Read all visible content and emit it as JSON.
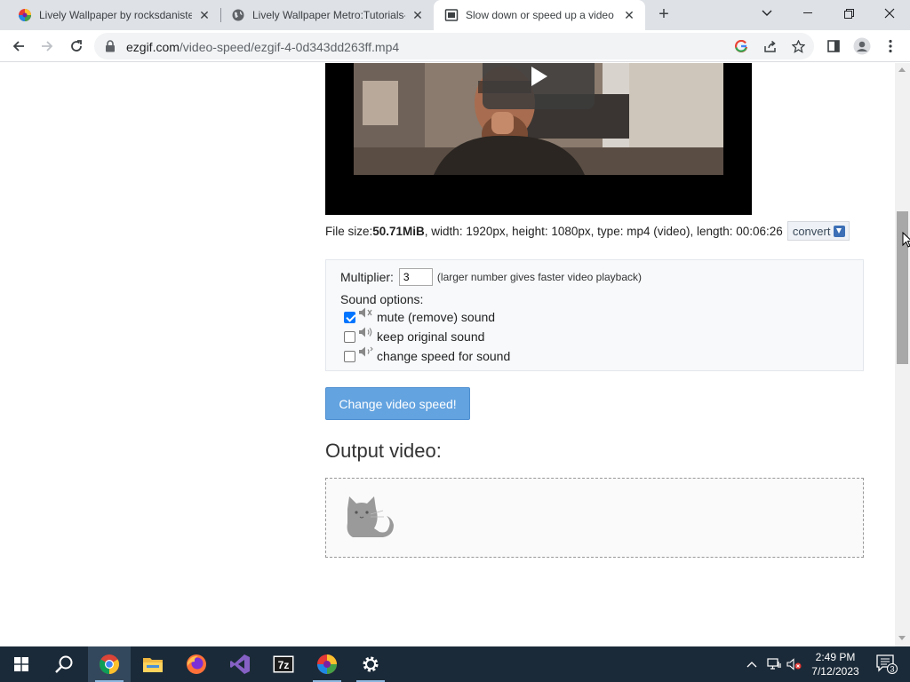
{
  "browser": {
    "tabs": [
      {
        "title": "Lively Wallpaper by rocksdanister",
        "active": false
      },
      {
        "title": "Lively Wallpaper Metro:Tutorials-",
        "active": false
      },
      {
        "title": "Slow down or speed up a video -",
        "active": true
      }
    ],
    "url_host": "ezgif.com",
    "url_path": "/video-speed/ezgif-4-0d343dd263ff.mp4"
  },
  "page": {
    "file_info": {
      "size_label": "File size: ",
      "size_value": "50.71MiB",
      "details": ", width: 1920px, height: 1080px, type: mp4 (video), length: 00:06:26",
      "convert_label": "convert"
    },
    "options": {
      "multiplier_label": "Multiplier:",
      "multiplier_value": "3",
      "multiplier_hint": "(larger number gives faster video playback)",
      "sound_label": "Sound options:",
      "sound_choices": [
        {
          "label": "mute (remove) sound",
          "checked": true
        },
        {
          "label": "keep original sound",
          "checked": false
        },
        {
          "label": "change speed for sound",
          "checked": false
        }
      ]
    },
    "submit_label": "Change video speed!",
    "output_title": "Output video:"
  },
  "taskbar": {
    "time": "2:49 PM",
    "date": "7/12/2023",
    "notification_count": "3"
  },
  "colors": {
    "accent_button": "#63a3e0",
    "taskbar": "#1b2a38",
    "checkbox": "#0075ff"
  }
}
